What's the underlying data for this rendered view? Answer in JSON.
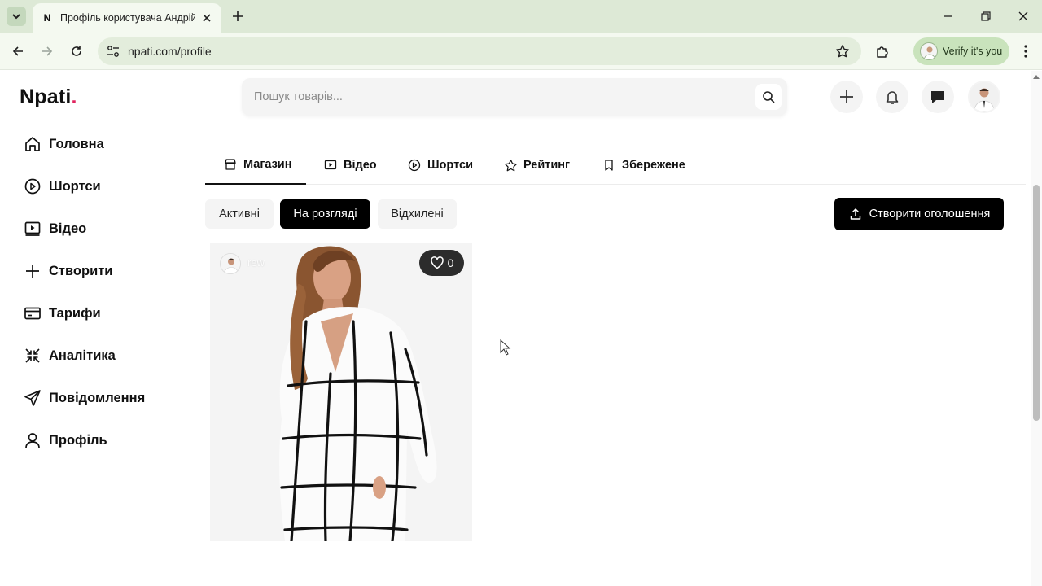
{
  "browser": {
    "tab_favicon": "N",
    "tab_title": "Профіль користувача Андрій",
    "url": "npati.com/profile",
    "verify_label": "Verify it's you",
    "icons": [
      "chevron-down-icon",
      "close-icon",
      "plus-icon",
      "minimize-icon",
      "restore-icon",
      "back-icon",
      "forward-icon",
      "reload-icon",
      "tune-icon",
      "star-icon",
      "extensions-icon",
      "more-vert-icon"
    ]
  },
  "header": {
    "logo": "Npati",
    "logo_dot": ".",
    "search_placeholder": "Пошук товарів...",
    "brand_color": "#e0245e"
  },
  "sidebar": {
    "items": [
      {
        "label": "Головна",
        "icon": "home-icon"
      },
      {
        "label": "Шортси",
        "icon": "play-circle-icon"
      },
      {
        "label": "Відео",
        "icon": "video-icon"
      },
      {
        "label": "Створити",
        "icon": "plus-icon"
      },
      {
        "label": "Тарифи",
        "icon": "credit-card-icon"
      },
      {
        "label": "Аналітика",
        "icon": "shrink-icon"
      },
      {
        "label": "Повідомлення",
        "icon": "send-icon"
      },
      {
        "label": "Профіль",
        "icon": "user-icon"
      }
    ]
  },
  "profile_tabs": {
    "items": [
      {
        "label": "Магазин",
        "icon": "store-icon",
        "active": true
      },
      {
        "label": "Відео",
        "icon": "video-icon",
        "active": false
      },
      {
        "label": "Шортси",
        "icon": "play-circle-icon",
        "active": false
      },
      {
        "label": "Рейтинг",
        "icon": "star-icon",
        "active": false
      },
      {
        "label": "Збережене",
        "icon": "bookmark-icon",
        "active": false
      }
    ]
  },
  "filters": {
    "items": [
      {
        "label": "Активні",
        "active": false
      },
      {
        "label": "На розгляді",
        "active": true
      },
      {
        "label": "Відхилені",
        "active": false
      }
    ]
  },
  "create_ad_label": "Створити оголошення",
  "product_card": {
    "username": "rew",
    "likes": "0"
  }
}
